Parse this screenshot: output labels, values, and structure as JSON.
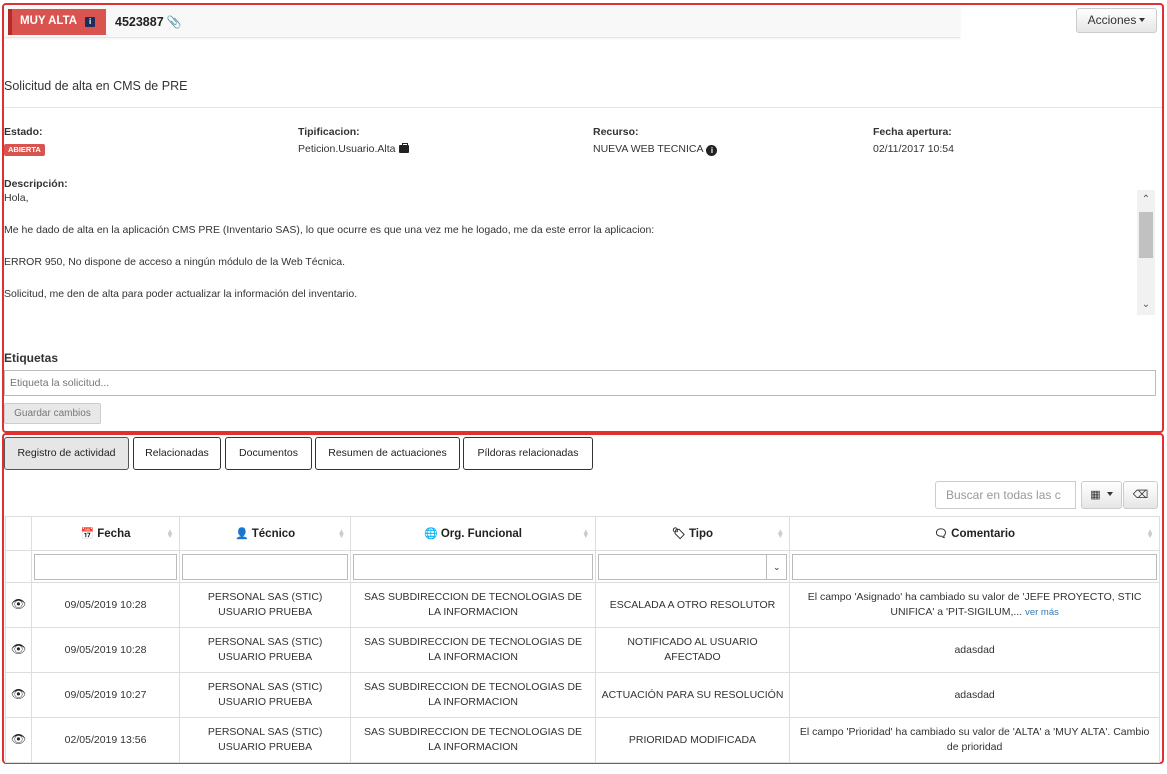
{
  "header": {
    "priority_label": "MUY ALTA",
    "priority_icon": "info-square-icon",
    "ticket_id": "4523887",
    "attachment_icon": "paperclip-icon",
    "actions_label": "Acciones",
    "priority_color": "#d9534f"
  },
  "subject": "Solicitud de alta en CMS de PRE",
  "fields": {
    "estado_label": "Estado:",
    "estado_value": "ABIERTA",
    "tipificacion_label": "Tipificacion:",
    "tipificacion_value": "Peticion.Usuario.Alta",
    "recurso_label": "Recurso:",
    "recurso_value": "NUEVA WEB TECNICA",
    "fecha_label": "Fecha apertura:",
    "fecha_value": "02/11/2017 10:54"
  },
  "description": {
    "label": "Descripción:",
    "lines": [
      "Hola,",
      "Me he dado de alta en la aplicación CMS PRE (Inventario SAS), lo que ocurre es que una vez me he logado, me da este error la aplicacion:",
      "ERROR 950, No dispone de acceso a ningún módulo de la Web Técnica.",
      "Solicitud, me den de alta para poder actualizar la información del inventario."
    ]
  },
  "tags": {
    "label": "Etiquetas",
    "placeholder": "Etiqueta la solicitud...",
    "save_label": "Guardar cambios"
  },
  "tabs": [
    {
      "label": "Registro de actividad",
      "active": true
    },
    {
      "label": "Relacionadas",
      "active": false
    },
    {
      "label": "Documentos",
      "active": false
    },
    {
      "label": "Resumen de actuaciones",
      "active": false
    },
    {
      "label": "Píldoras relacionadas",
      "active": false
    }
  ],
  "table_tools": {
    "search_placeholder": "Buscar en todas las c",
    "columns_icon": "grid-icon",
    "clear_icon": "eraser-icon"
  },
  "table": {
    "headers": [
      "Fecha",
      "Técnico",
      "Org. Funcional",
      "Tipo",
      "Comentario"
    ],
    "header_icons": [
      "calendar-icon",
      "user-icon",
      "globe-icon",
      "tag-icon",
      "comment-icon"
    ],
    "rows": [
      {
        "fecha": "09/05/2019 10:28",
        "tecnico": "PERSONAL SAS (STIC) USUARIO PRUEBA",
        "org": "SAS SUBDIRECCION DE TECNOLOGIAS DE LA INFORMACION",
        "tipo": "ESCALADA A OTRO RESOLUTOR",
        "comentario": "El campo 'Asignado' ha cambiado su valor de 'JEFE PROYECTO, STIC UNIFICA' a 'PIT-SIGILUM,...",
        "ver_mas": "ver más"
      },
      {
        "fecha": "09/05/2019 10:28",
        "tecnico": "PERSONAL SAS (STIC) USUARIO PRUEBA",
        "org": "SAS SUBDIRECCION DE TECNOLOGIAS DE LA INFORMACION",
        "tipo": "NOTIFICADO AL USUARIO AFECTADO",
        "comentario": "adasdad",
        "ver_mas": ""
      },
      {
        "fecha": "09/05/2019 10:27",
        "tecnico": "PERSONAL SAS (STIC) USUARIO PRUEBA",
        "org": "SAS SUBDIRECCION DE TECNOLOGIAS DE LA INFORMACION",
        "tipo": "ACTUACIÓN PARA SU RESOLUCIÓN",
        "comentario": "adasdad",
        "ver_mas": ""
      },
      {
        "fecha": "02/05/2019 13:56",
        "tecnico": "PERSONAL SAS (STIC) USUARIO PRUEBA",
        "org": "SAS SUBDIRECCION DE TECNOLOGIAS DE LA INFORMACION",
        "tipo": "PRIORIDAD MODIFICADA",
        "comentario": "El campo 'Prioridad' ha cambiado su valor de 'ALTA' a 'MUY ALTA'. Cambio de prioridad",
        "ver_mas": ""
      }
    ]
  }
}
